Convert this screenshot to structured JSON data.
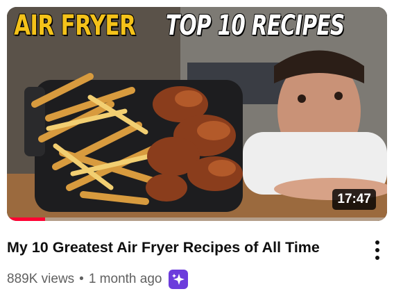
{
  "thumbnail": {
    "headline_yellow": "AIR FRYER",
    "headline_white": "TOP 10 RECIPES",
    "duration": "17:47",
    "watch_progress": 0.1,
    "progress_color": "#ff0033"
  },
  "video": {
    "title": "My 10 Greatest Air Fryer Recipes of All Time",
    "views": "889K views",
    "separator": "•",
    "age": "1 month ago"
  },
  "icons": {
    "menu": "more-vert-icon",
    "badge": "sparkle-icon",
    "badge_color": "#6c3cdc"
  }
}
